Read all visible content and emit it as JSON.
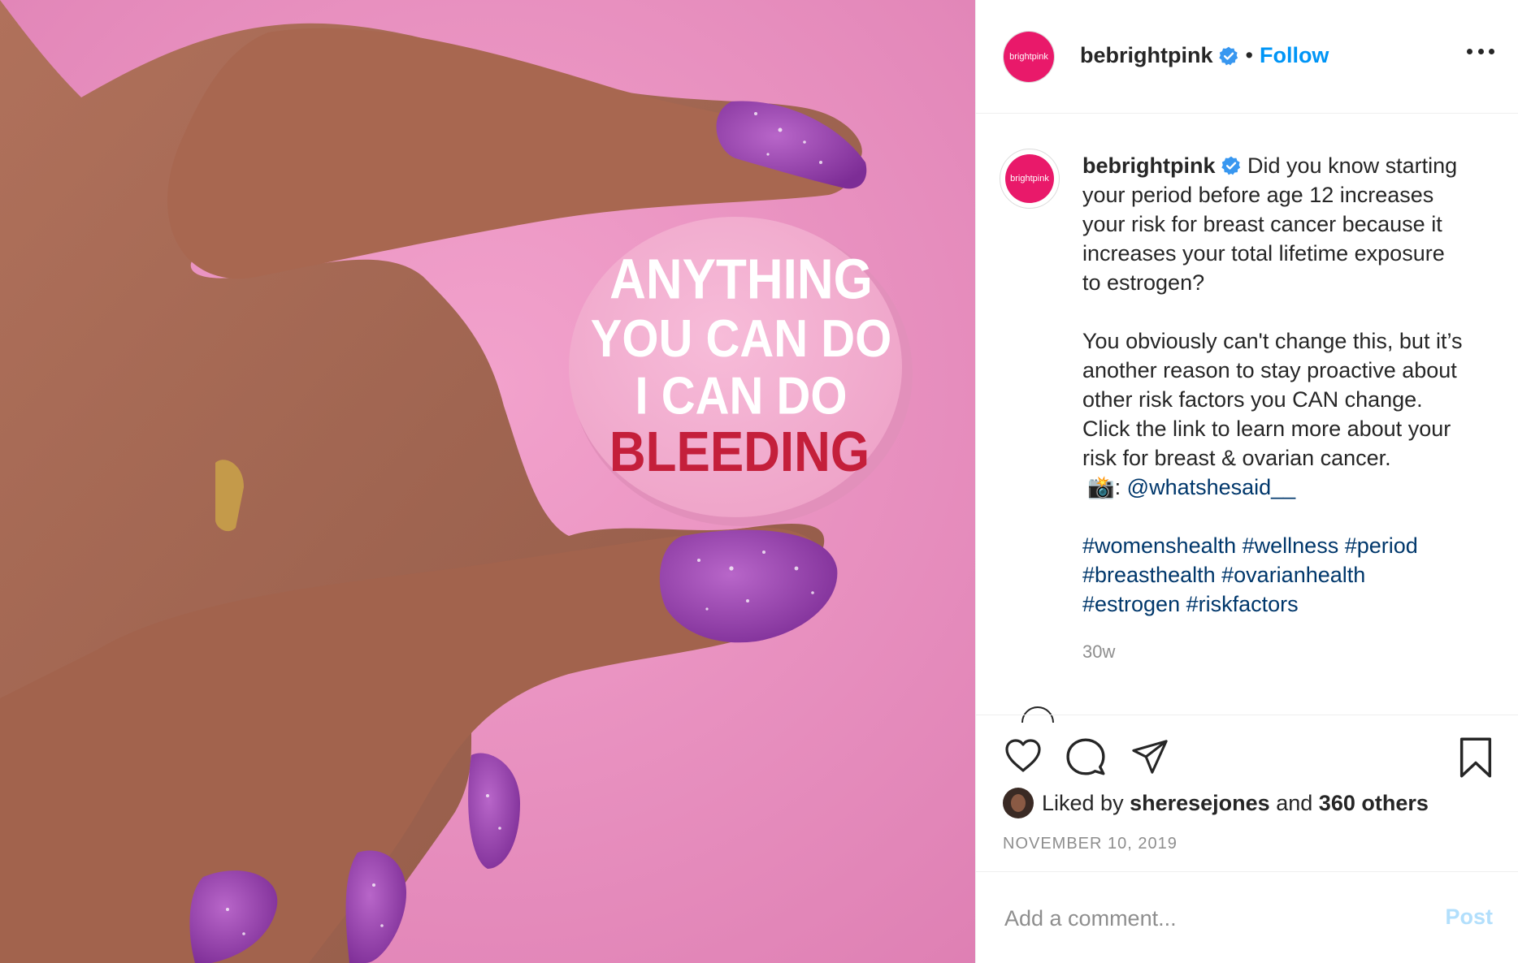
{
  "post": {
    "username": "bebrightpink",
    "follow_label": "Follow",
    "separator": "•",
    "avatar_text": "brightpink",
    "button_text": [
      "ANYTHING",
      "YOU CAN DO",
      "I CAN DO",
      "BLEEDING"
    ]
  },
  "caption": {
    "username": "bebrightpink",
    "line1": "Did you know starting",
    "line2": "your period before age 12 increases",
    "line3": "your risk for breast cancer because it",
    "line4": "increases your total lifetime exposure",
    "line5": "to estrogen?",
    "para2_line1": "You obviously can't change this, but it’s",
    "para2_line2": "another reason to stay proactive about",
    "para2_line3": "other risk factors you CAN change.",
    "para2_line4": "Click the link to learn more about your",
    "para2_line5": "risk for breast & ovarian cancer.",
    "camera_emoji": "📸",
    "credit_prefix": ":",
    "credit_handle": "@whatshesaid__",
    "hashtags_line1": [
      "#womenshealth",
      "#wellness",
      "#period"
    ],
    "hashtags_line2": [
      "#breasthealth",
      "#ovarianhealth"
    ],
    "hashtags_line3": [
      "#estrogen",
      "#riskfactors"
    ],
    "time": "30w"
  },
  "likes": {
    "prefix": "Liked by",
    "user": "sheresejones",
    "middle": "and",
    "others": "360 others"
  },
  "date": "NOVEMBER 10, 2019",
  "comment": {
    "placeholder": "Add a comment...",
    "post_label": "Post"
  },
  "icons": {
    "like": "heart-icon",
    "comment": "comment-icon",
    "share": "share-icon",
    "save": "bookmark-icon",
    "verified": "verified-badge-icon",
    "more": "more-options-icon"
  },
  "colors": {
    "brand_pink": "#e9196a",
    "follow_blue": "#0095f6",
    "link": "#00376b",
    "verified_blue": "#3897f0",
    "background_pink": "#e98fbf"
  }
}
